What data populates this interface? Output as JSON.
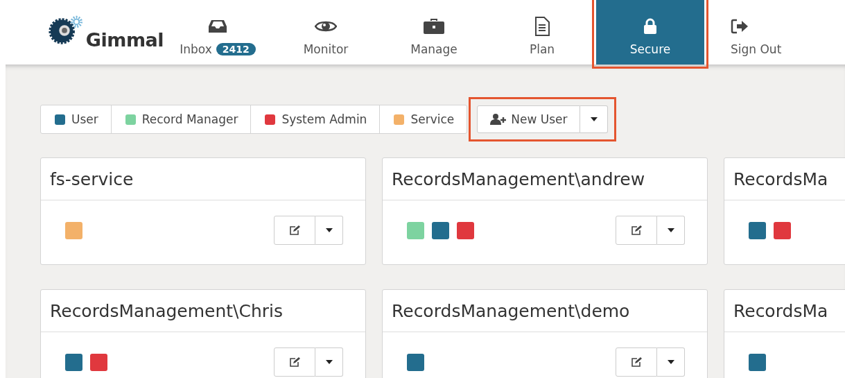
{
  "logo": {
    "text": "Gimmal"
  },
  "nav": [
    {
      "label": "Inbox",
      "kind": "inbox",
      "badge": "2412",
      "selected": false,
      "highlighted": false
    },
    {
      "label": "Monitor",
      "kind": "eye",
      "selected": false,
      "highlighted": false
    },
    {
      "label": "Manage",
      "kind": "briefcase",
      "selected": false,
      "highlighted": false
    },
    {
      "label": "Plan",
      "kind": "document",
      "selected": false,
      "highlighted": false
    },
    {
      "label": "Secure",
      "kind": "lock",
      "selected": true,
      "highlighted": true
    },
    {
      "label": "Sign Out",
      "kind": "signout",
      "selected": false,
      "highlighted": false
    }
  ],
  "legend": [
    {
      "label": "User",
      "color": "#236d8e"
    },
    {
      "label": "Record Manager",
      "color": "#7dd3a0"
    },
    {
      "label": "System Admin",
      "color": "#e0383e"
    },
    {
      "label": "Service",
      "color": "#f3b169"
    }
  ],
  "new_user": {
    "label": "New User",
    "highlighted": true
  },
  "users": [
    {
      "name": "fs-service",
      "roles": [
        {
          "color": "#f3b169"
        }
      ]
    },
    {
      "name": "RecordsManagement\\andrew",
      "roles": [
        {
          "color": "#7dd3a0"
        },
        {
          "color": "#236d8e"
        },
        {
          "color": "#e0383e"
        }
      ]
    },
    {
      "name": "RecordsMa",
      "roles": [
        {
          "color": "#236d8e"
        },
        {
          "color": "#e0383e"
        }
      ]
    },
    {
      "name": "RecordsManagement\\Chris",
      "roles": [
        {
          "color": "#236d8e"
        },
        {
          "color": "#e0383e"
        }
      ]
    },
    {
      "name": "RecordsManagement\\demo",
      "roles": [
        {
          "color": "#236d8e"
        }
      ]
    },
    {
      "name": "RecordsMa",
      "roles": [
        {
          "color": "#236d8e"
        }
      ]
    }
  ]
}
